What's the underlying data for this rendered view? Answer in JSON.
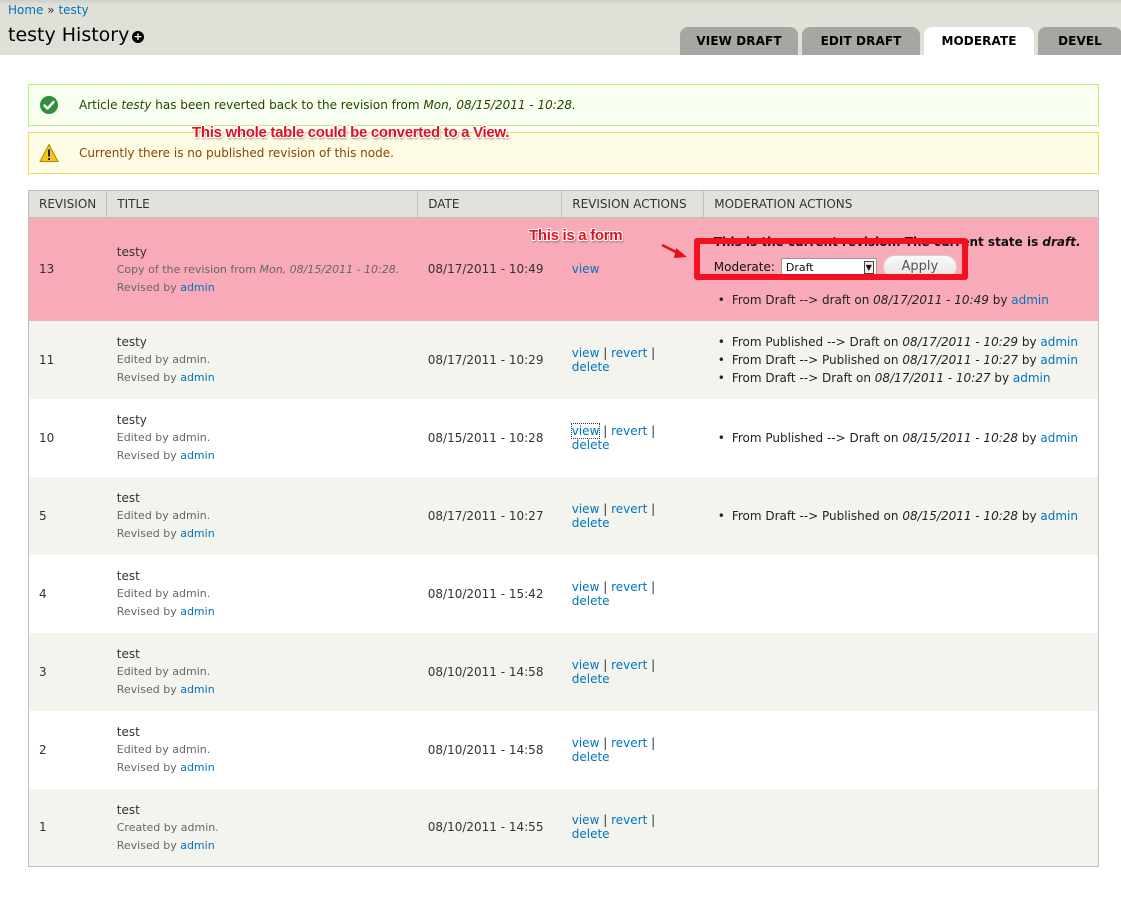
{
  "breadcrumb": {
    "items": [
      "Home",
      "testy"
    ],
    "separator": "»"
  },
  "page": {
    "title": "testy History",
    "shortcut_icon": "plus-circle-icon"
  },
  "tabs": [
    {
      "label": "VIEW DRAFT",
      "active": false
    },
    {
      "label": "EDIT DRAFT",
      "active": false
    },
    {
      "label": "MODERATE",
      "active": true
    },
    {
      "label": "DEVEL",
      "active": false
    }
  ],
  "messages": {
    "status": {
      "icon": "check-circle-icon",
      "prefix": "Article ",
      "node_title": "testy",
      "middle": " has been reverted back to the revision from ",
      "date": "Mon, 08/15/2011 - 10:28."
    },
    "warning": {
      "icon": "warning-triangle-icon",
      "text": "Currently there is no published revision of this node."
    }
  },
  "annotations": {
    "table_note": "This whole table could be converted to a View.",
    "form_note": "This is a form"
  },
  "colors": {
    "link": "#0074bd",
    "current_row": "#f9aab8",
    "annotation_red": "#e3101e",
    "status_bg": "#f8fff0",
    "warning_bg": "#fffce5"
  },
  "table": {
    "headers": [
      "REVISION",
      "TITLE",
      "DATE",
      "REVISION ACTIONS",
      "MODERATION ACTIONS"
    ],
    "current_revision": {
      "state_prefix": "This is the current revision. The current state is ",
      "state": "draft.",
      "form": {
        "label": "Moderate:",
        "selected": "Draft",
        "apply_label": "Apply"
      }
    },
    "rows": [
      {
        "revision": "13",
        "title": "testy",
        "log_prefix": "Copy of the revision from ",
        "log_date": "Mon, 08/15/2011 - 10:28.",
        "revised_by": "Revised by ",
        "user": "admin",
        "date": "08/17/2011 - 10:49",
        "actions": [
          "view"
        ],
        "history": [
          {
            "text": "From Draft --> draft on ",
            "date": "08/17/2011 - 10:49",
            "by": " by ",
            "user": "admin"
          }
        ]
      },
      {
        "revision": "11",
        "title": "testy",
        "log": "Edited by admin.",
        "revised_by": "Revised by ",
        "user": "admin",
        "date": "08/17/2011 - 10:29",
        "actions": [
          "view",
          "revert",
          "delete"
        ],
        "history": [
          {
            "text": "From Published --> Draft on ",
            "date": "08/17/2011 - 10:29",
            "by": " by ",
            "user": "admin"
          },
          {
            "text": "From Draft --> Published on ",
            "date": "08/17/2011 - 10:27",
            "by": " by ",
            "user": "admin"
          },
          {
            "text": "From Draft --> Draft on ",
            "date": "08/17/2011 - 10:27",
            "by": " by ",
            "user": "admin"
          }
        ]
      },
      {
        "revision": "10",
        "title": "testy",
        "log": "Edited by admin.",
        "revised_by": "Revised by ",
        "user": "admin",
        "date": "08/15/2011 - 10:28",
        "actions": [
          "view",
          "revert",
          "delete"
        ],
        "history": [
          {
            "text": "From Published --> Draft on ",
            "date": "08/15/2011 - 10:28",
            "by": " by ",
            "user": "admin"
          }
        ]
      },
      {
        "revision": "5",
        "title": "test",
        "log": "Edited by admin.",
        "revised_by": "Revised by ",
        "user": "admin",
        "date": "08/17/2011 - 10:27",
        "actions": [
          "view",
          "revert",
          "delete"
        ],
        "history": [
          {
            "text": "From Draft --> Published on ",
            "date": "08/15/2011 - 10:28",
            "by": " by ",
            "user": "admin"
          }
        ]
      },
      {
        "revision": "4",
        "title": "test",
        "log": "Edited by admin.",
        "revised_by": "Revised by ",
        "user": "admin",
        "date": "08/10/2011 - 15:42",
        "actions": [
          "view",
          "revert",
          "delete"
        ],
        "history": []
      },
      {
        "revision": "3",
        "title": "test",
        "log": "Edited by admin.",
        "revised_by": "Revised by ",
        "user": "admin",
        "date": "08/10/2011 - 14:58",
        "actions": [
          "view",
          "revert",
          "delete"
        ],
        "history": []
      },
      {
        "revision": "2",
        "title": "test",
        "log": "Edited by admin.",
        "revised_by": "Revised by ",
        "user": "admin",
        "date": "08/10/2011 - 14:58",
        "actions": [
          "view",
          "revert",
          "delete"
        ],
        "history": []
      },
      {
        "revision": "1",
        "title": "test",
        "log": "Created by admin.",
        "revised_by": "Revised by ",
        "user": "admin",
        "date": "08/10/2011 - 14:55",
        "actions": [
          "view",
          "revert",
          "delete"
        ],
        "history": []
      }
    ]
  }
}
